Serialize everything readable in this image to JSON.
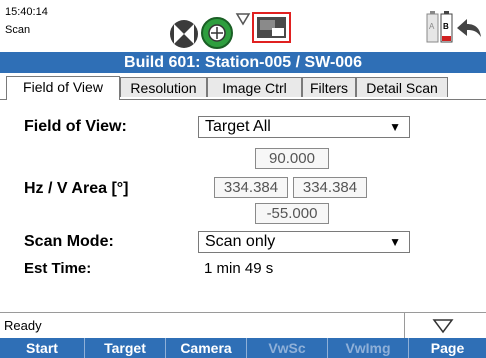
{
  "status_bar": {
    "time": "15:40:14",
    "mode": "Scan",
    "battery_a": "A",
    "battery_b": "B",
    "icons": [
      "nav-cross-icon",
      "target-sync-icon",
      "signal-icon",
      "camera-icon",
      "battery-icon",
      "back-arrow-icon"
    ]
  },
  "header": {
    "title": "Build 601: Station-005 / SW-006"
  },
  "tabs": [
    {
      "label": "Field of View",
      "active": true
    },
    {
      "label": "Resolution"
    },
    {
      "label": "Image Ctrl"
    },
    {
      "label": "Filters"
    },
    {
      "label": "Detail Scan"
    }
  ],
  "form": {
    "fov_label": "Field of View:",
    "fov_value": "Target All",
    "area_label": "Hz / V Area [°]",
    "v_top": "90.000",
    "hz_left": "334.384",
    "hz_right": "334.384",
    "v_bottom": "-55.000",
    "scan_mode_label": "Scan Mode:",
    "scan_mode_value": "Scan only",
    "est_time_label": "Est Time:",
    "est_time_value": "1 min 49 s"
  },
  "footer": {
    "status": "Ready"
  },
  "softkeys": [
    {
      "label": "Start",
      "enabled": true
    },
    {
      "label": "Target",
      "enabled": true
    },
    {
      "label": "Camera",
      "enabled": true
    },
    {
      "label": "VwSc",
      "enabled": false
    },
    {
      "label": "VwImg",
      "enabled": false
    },
    {
      "label": "Page",
      "enabled": true
    }
  ],
  "colors": {
    "accent": "#2f6fb6",
    "highlight_red": "#e02020",
    "battery_low": "#d02020",
    "green": "#2e9e3e"
  }
}
